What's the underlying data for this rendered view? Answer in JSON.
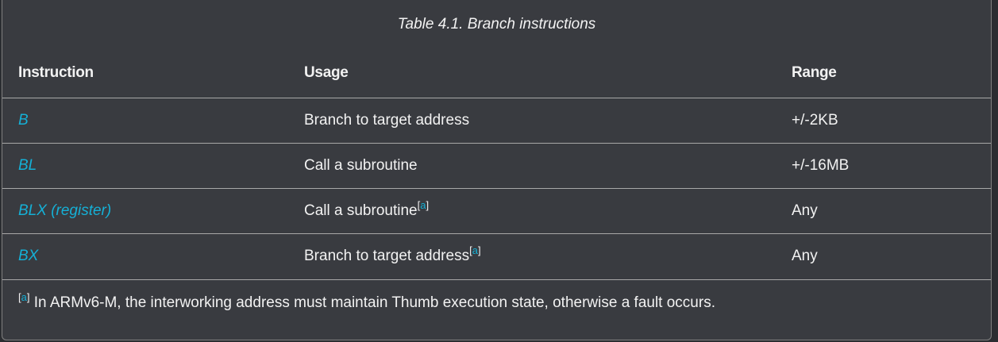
{
  "caption": "Table 4.1. Branch instructions",
  "headers": {
    "instruction": "Instruction",
    "usage": "Usage",
    "range": "Range"
  },
  "rows": [
    {
      "instruction": "B",
      "usage": "Branch to target address",
      "footnote_ref": "",
      "range": "+/-2KB"
    },
    {
      "instruction": "BL",
      "usage": "Call a subroutine",
      "footnote_ref": "",
      "range": "+/-16MB"
    },
    {
      "instruction": "BLX (register)",
      "usage": "Call a subroutine",
      "footnote_ref": "a",
      "range": "Any"
    },
    {
      "instruction": "BX",
      "usage": "Branch to target address",
      "footnote_ref": "a",
      "range": "Any"
    }
  ],
  "footnote": {
    "marker": "a",
    "text": "In ARMv6-M, the interworking address must maintain Thumb execution state, otherwise a fault occurs."
  },
  "colors": {
    "background": "#393b40",
    "link": "#15b0d6",
    "text": "#f2f2f2",
    "rule": "#a8a8a8"
  }
}
